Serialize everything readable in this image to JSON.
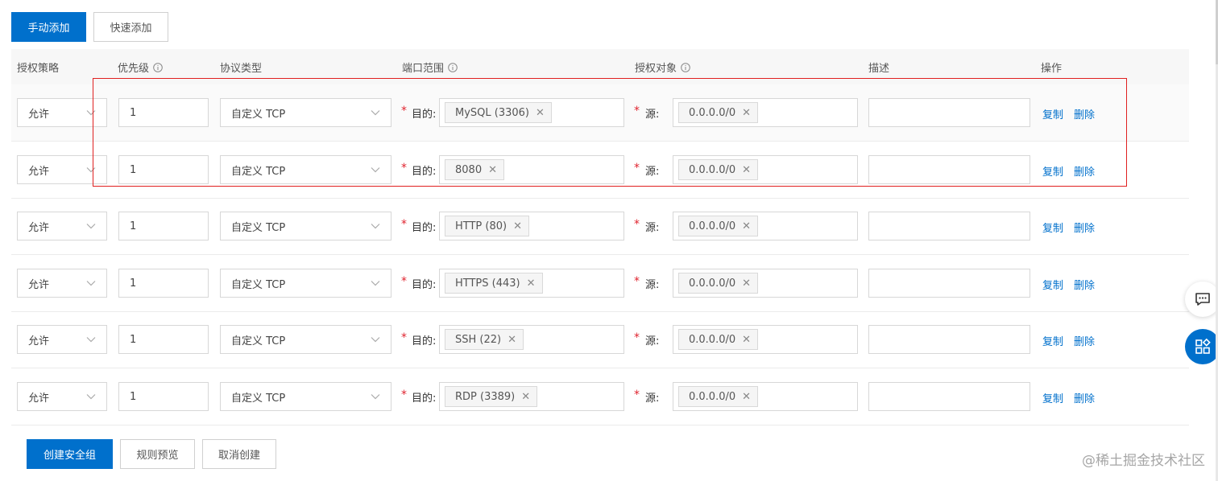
{
  "toolbar": {
    "manual_add": "手动添加",
    "quick_add": "快速添加"
  },
  "table": {
    "headers": {
      "policy": "授权策略",
      "priority": "优先级",
      "protocol": "协议类型",
      "port_range": "端口范围",
      "auth_object": "授权对象",
      "description": "描述",
      "actions": "操作"
    },
    "dest_label": "目的:",
    "source_label": "源:",
    "copy_label": "复制",
    "delete_label": "删除",
    "rows": [
      {
        "policy": "允许",
        "priority": "1",
        "protocol": "自定义 TCP",
        "port": "MySQL (3306)",
        "source": "0.0.0.0/0",
        "description": ""
      },
      {
        "policy": "允许",
        "priority": "1",
        "protocol": "自定义 TCP",
        "port": "8080",
        "source": "0.0.0.0/0",
        "description": ""
      },
      {
        "policy": "允许",
        "priority": "1",
        "protocol": "自定义 TCP",
        "port": "HTTP (80)",
        "source": "0.0.0.0/0",
        "description": ""
      },
      {
        "policy": "允许",
        "priority": "1",
        "protocol": "自定义 TCP",
        "port": "HTTPS (443)",
        "source": "0.0.0.0/0",
        "description": ""
      },
      {
        "policy": "允许",
        "priority": "1",
        "protocol": "自定义 TCP",
        "port": "SSH (22)",
        "source": "0.0.0.0/0",
        "description": ""
      },
      {
        "policy": "允许",
        "priority": "1",
        "protocol": "自定义 TCP",
        "port": "RDP (3389)",
        "source": "0.0.0.0/0",
        "description": ""
      }
    ]
  },
  "footer": {
    "create": "创建安全组",
    "preview": "规则预览",
    "cancel": "取消创建"
  },
  "side_buttons": [
    {
      "icon": "chat-icon"
    },
    {
      "icon": "apps-icon"
    }
  ],
  "watermark": "@稀土掘金技术社区",
  "colors": {
    "primary": "#0070cc",
    "required": "#e0232e",
    "highlight": "#e02020"
  }
}
